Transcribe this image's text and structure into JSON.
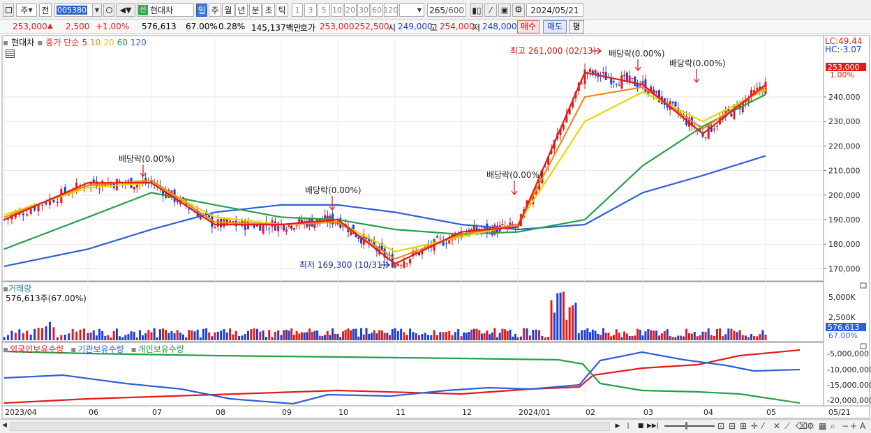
{
  "toolbar": {
    "market_type": "주",
    "prev_label": "전",
    "stock_code": "005380",
    "sin_badge": "신",
    "stock_name": "현대차",
    "periods": [
      "일",
      "주",
      "월",
      "년",
      "분",
      "초",
      "틱"
    ],
    "active_period": "일",
    "intervals": [
      "1",
      "3",
      "5",
      "10",
      "20",
      "30",
      "60",
      "120"
    ],
    "count": "265",
    "count_max": "/600",
    "date": "2024/05/21"
  },
  "price_bar": {
    "price": "253,000",
    "up_arrow": "▲",
    "change": "2,500",
    "change_rate": "+1.00%",
    "volume": "576,613",
    "volume_ratio": "67.00%",
    "turnover_rate": "0.28%",
    "trade_value": "145,137백만",
    "quote_label": "호가",
    "ask": "253,000",
    "bid": "252,500",
    "open_label": "시",
    "open": "249,000",
    "high_label": "고",
    "high": "254,000",
    "low_label": "저",
    "low": "248,000",
    "buy_button": "매수",
    "sell_button": "매도",
    "avg_button": "평"
  },
  "price_panel": {
    "name": "현대차",
    "indicator": "종가 단순",
    "ma_periods": [
      {
        "label": "5",
        "color": "#e21b1b"
      },
      {
        "label": "10",
        "color": "#f08b14"
      },
      {
        "label": "20",
        "color": "#e8d800"
      },
      {
        "label": "60",
        "color": "#24a04a"
      },
      {
        "label": "120",
        "color": "#2e5fd8"
      }
    ],
    "lc": "LC:49.44",
    "hc": "HC:-3.07",
    "current_tag": "253,000",
    "current_pct": "1.00%",
    "y_ticks": [
      "240,000",
      "230,000",
      "220,000",
      "210,000",
      "200,000",
      "190,000",
      "180,000",
      "170,000"
    ],
    "annotations": {
      "high": "최고 261,000 (02/13)",
      "low": "최저 169,300 (10/31)",
      "dividends": [
        "배당락(0.00%)",
        "배당락(0.00%)",
        "배당락(0.00%)",
        "배당락(0.00%)",
        "배당락(0.00%)"
      ]
    }
  },
  "volume_panel": {
    "title": "거래량",
    "value": "576,613주(67.00%)",
    "y_ticks": [
      "5,000K",
      "2,500K"
    ],
    "current_tag": "576,613",
    "current_pct": "67.00%"
  },
  "holdings_panel": {
    "series": [
      {
        "label": "외국인보유수량",
        "color": "#e21b1b"
      },
      {
        "label": "기관보유수량",
        "color": "#2e5fd8"
      },
      {
        "label": "개인보유수량",
        "color": "#24a04a"
      }
    ],
    "y_ticks": [
      "-5,000,000",
      "-10,000,000",
      "-15,000,000",
      "-20,000,000"
    ]
  },
  "x_axis": {
    "labels": [
      "2023/04",
      "06",
      "07",
      "08",
      "09",
      "10",
      "11",
      "12",
      "2024/01",
      "02",
      "03",
      "04",
      "05",
      "05/21"
    ]
  },
  "chart_data": {
    "type": "line",
    "unit": "KRW",
    "x": [
      "2023/04",
      "06",
      "07",
      "08",
      "09",
      "10",
      "11",
      "12",
      "2024/01",
      "02",
      "03",
      "04",
      "05",
      "05/21"
    ],
    "series": [
      {
        "name": "5",
        "color": "#e21b1b",
        "values": [
          190000,
          205000,
          205000,
          188000,
          188000,
          190000,
          172000,
          185000,
          187000,
          250000,
          245000,
          225000,
          245000,
          253000
        ]
      },
      {
        "name": "10",
        "color": "#f08b14",
        "values": [
          191000,
          204000,
          206000,
          189000,
          188000,
          189000,
          174000,
          184000,
          188000,
          240000,
          244000,
          227000,
          244000,
          249000
        ]
      },
      {
        "name": "20",
        "color": "#e8d800",
        "values": [
          192000,
          203000,
          205000,
          191000,
          188000,
          189000,
          177000,
          183000,
          188000,
          230000,
          242000,
          230000,
          243000,
          246000
        ]
      },
      {
        "name": "60",
        "color": "#24a04a",
        "values": [
          178000,
          191000,
          201000,
          196000,
          191000,
          190000,
          186000,
          184000,
          185000,
          190000,
          212000,
          228000,
          241000,
          242000
        ]
      },
      {
        "name": "120",
        "color": "#2e5fd8",
        "values": [
          171000,
          178000,
          186000,
          193000,
          196000,
          196000,
          193000,
          188000,
          186000,
          188000,
          201000,
          208000,
          216000,
          220000
        ]
      }
    ],
    "y_range": [
      165000,
      265000
    ],
    "annotations": [
      {
        "text": "최고 261,000 (02/13)",
        "x": "02",
        "y": 261000
      },
      {
        "text": "최저 169,300 (10/31)",
        "x": "11",
        "y": 169300
      }
    ],
    "grid": true
  }
}
